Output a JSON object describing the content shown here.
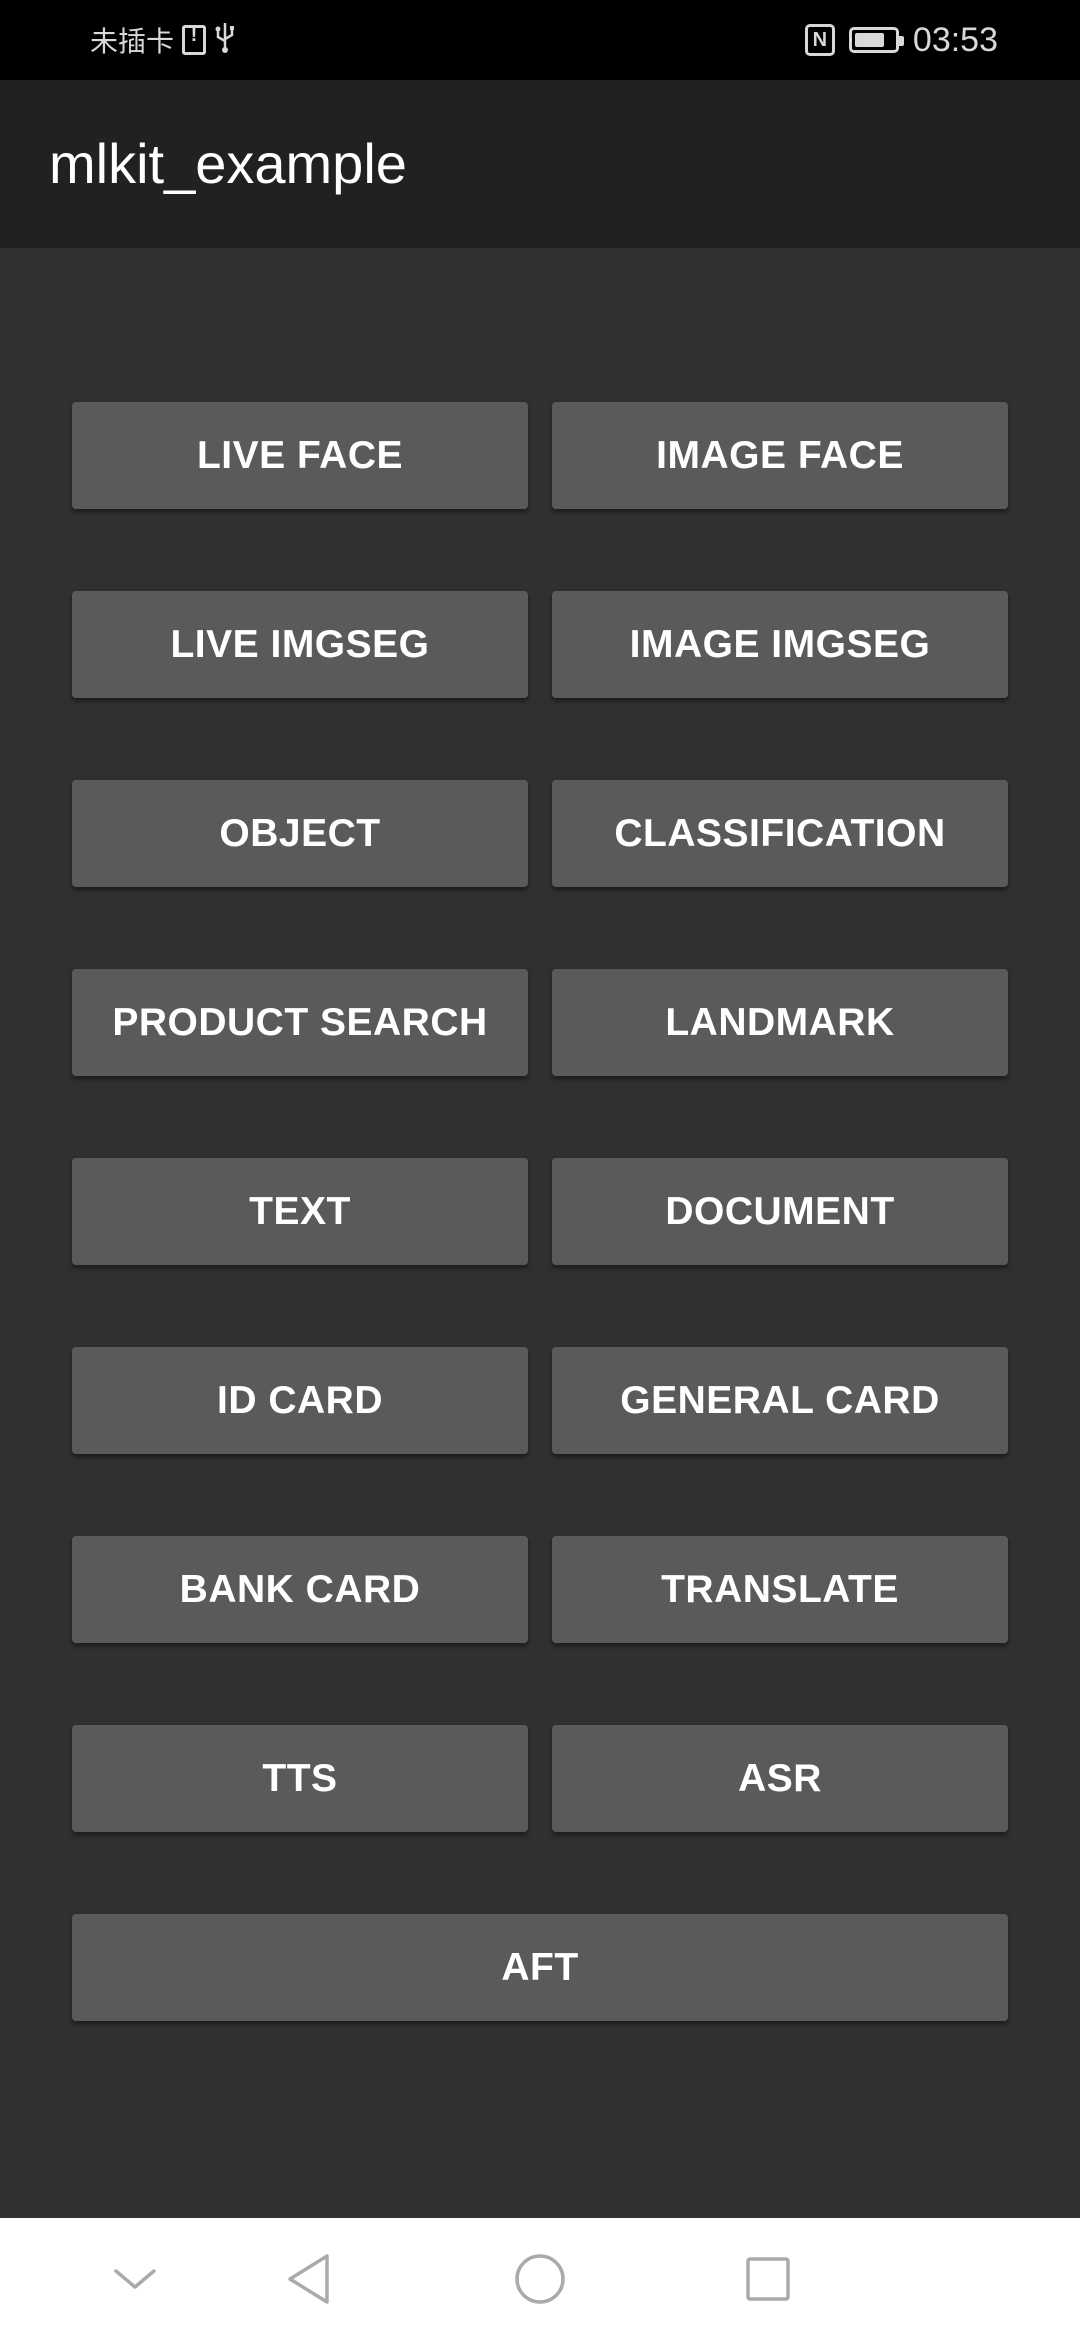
{
  "status_bar": {
    "carrier_text": "未插卡",
    "time": "03:53",
    "battery_level": 0.75,
    "icons": [
      "sim-alert-icon",
      "usb-icon",
      "nfc-icon",
      "battery-icon"
    ]
  },
  "app_bar": {
    "title": "mlkit_example"
  },
  "buttons": [
    {
      "label": "LIVE FACE"
    },
    {
      "label": "IMAGE FACE"
    },
    {
      "label": "LIVE IMGSEG"
    },
    {
      "label": "IMAGE IMGSEG"
    },
    {
      "label": "OBJECT"
    },
    {
      "label": "CLASSIFICATION"
    },
    {
      "label": "PRODUCT SEARCH"
    },
    {
      "label": "LANDMARK"
    },
    {
      "label": "TEXT"
    },
    {
      "label": "DOCUMENT"
    },
    {
      "label": "ID CARD"
    },
    {
      "label": "GENERAL CARD"
    },
    {
      "label": "BANK CARD"
    },
    {
      "label": "TRANSLATE"
    },
    {
      "label": "TTS"
    },
    {
      "label": "ASR"
    },
    {
      "label": "AFT"
    }
  ],
  "nav_bar": {
    "icons": [
      "chevron-down-icon",
      "back-icon",
      "home-icon",
      "recents-icon"
    ]
  },
  "colors": {
    "status_bar_bg": "#000000",
    "app_bar_bg": "#212121",
    "content_bg": "#303030",
    "button_bg": "#5a5a5c",
    "button_text": "#ffffff",
    "nav_bar_bg": "#ffffff",
    "nav_icon": "#aaaaaa"
  }
}
